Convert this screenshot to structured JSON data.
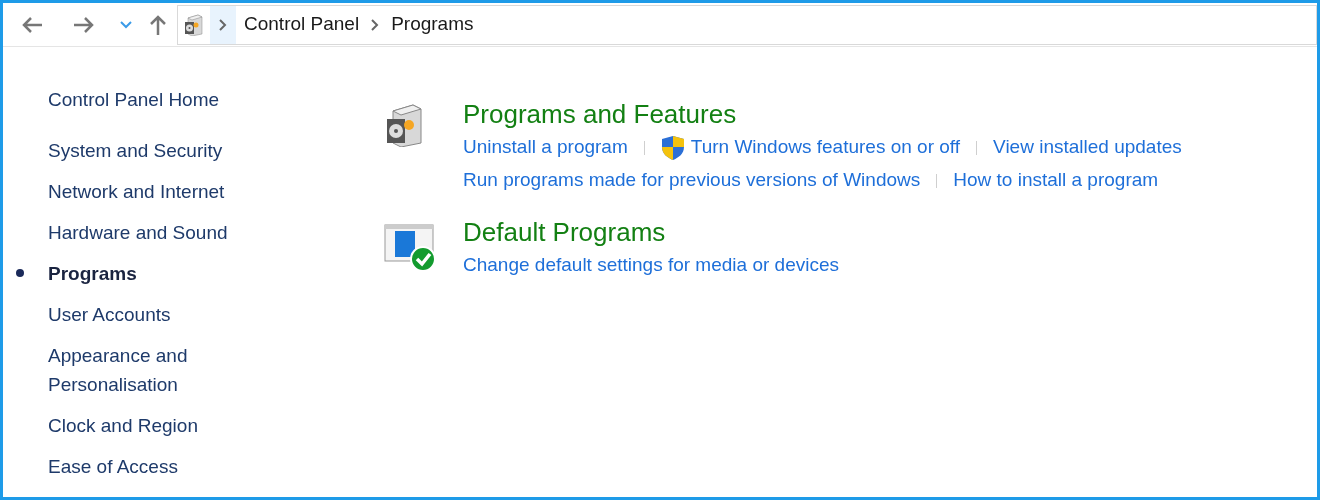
{
  "breadcrumb": [
    "Control Panel",
    "Programs"
  ],
  "sidebar": {
    "items": [
      {
        "label": "Control Panel Home",
        "selected": false,
        "kind": "home"
      },
      {
        "label": "System and Security",
        "selected": false,
        "kind": "category"
      },
      {
        "label": "Network and Internet",
        "selected": false,
        "kind": "category"
      },
      {
        "label": "Hardware and Sound",
        "selected": false,
        "kind": "category"
      },
      {
        "label": "Programs",
        "selected": true,
        "kind": "category"
      },
      {
        "label": "User Accounts",
        "selected": false,
        "kind": "category"
      },
      {
        "label": "Appearance and Personalisation",
        "selected": false,
        "kind": "category"
      },
      {
        "label": "Clock and Region",
        "selected": false,
        "kind": "category"
      },
      {
        "label": "Ease of Access",
        "selected": false,
        "kind": "category"
      }
    ]
  },
  "sections": [
    {
      "kind": "programs",
      "title": "Programs and Features",
      "link_rows": [
        [
          {
            "label": "Uninstall a program",
            "kind": "plain"
          },
          {
            "label": "Turn Windows features on or off",
            "kind": "shield"
          },
          {
            "label": "View installed updates",
            "kind": "plain"
          }
        ],
        [
          {
            "label": "Run programs made for previous versions of Windows",
            "kind": "plain"
          },
          {
            "label": "How to install a program",
            "kind": "plain"
          }
        ]
      ]
    },
    {
      "kind": "defaults",
      "title": "Default Programs",
      "link_rows": [
        [
          {
            "label": "Change default settings for media or devices",
            "kind": "plain"
          }
        ]
      ]
    }
  ]
}
